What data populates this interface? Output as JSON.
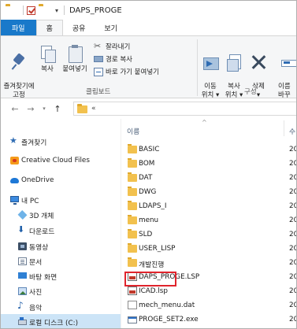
{
  "window": {
    "title": "DAPS_PROGE"
  },
  "tabs": {
    "file": "파일",
    "home": "홈",
    "share": "공유",
    "view": "보기"
  },
  "ribbon": {
    "pin": "즐겨찾기에\n고정",
    "copy": "복사",
    "paste": "붙여넣기",
    "cut": "잘라내기",
    "copy_path": "경로 복사",
    "paste_shortcut": "바로 가기 붙여넣기",
    "clipboard_group": "클립보드",
    "move_to": "이동\n위치 ▾",
    "copy_to": "복사\n위치 ▾",
    "delete": "삭제\n▾",
    "rename": "이름\n바꾸",
    "organize_group": "구성"
  },
  "address": {
    "path": "«"
  },
  "nav_pane": {
    "items": [
      {
        "label": "즐겨찾기",
        "icon": "star-icon"
      },
      {
        "label": "Creative Cloud Files",
        "icon": "creative-cloud-icon"
      },
      {
        "label": "OneDrive",
        "icon": "cloud-icon"
      },
      {
        "label": "내 PC",
        "icon": "computer-icon"
      },
      {
        "label": "3D 개체",
        "icon": "3d-objects-icon"
      },
      {
        "label": "다운로드",
        "icon": "download-icon"
      },
      {
        "label": "동영상",
        "icon": "video-icon"
      },
      {
        "label": "문서",
        "icon": "document-icon"
      },
      {
        "label": "바탕 화면",
        "icon": "desktop-icon"
      },
      {
        "label": "사진",
        "icon": "picture-icon"
      },
      {
        "label": "음악",
        "icon": "music-icon"
      },
      {
        "label": "로컬 디스크 (C:)",
        "icon": "disk-icon"
      }
    ]
  },
  "file_list": {
    "headers": {
      "name": "이름",
      "date": "수"
    },
    "rows": [
      {
        "name": "BASIC",
        "type": "folder",
        "date": "20"
      },
      {
        "name": "BOM",
        "type": "folder",
        "date": "20"
      },
      {
        "name": "DAT",
        "type": "folder",
        "date": "20"
      },
      {
        "name": "DWG",
        "type": "folder",
        "date": "20"
      },
      {
        "name": "LDAPS_I",
        "type": "folder",
        "date": "20"
      },
      {
        "name": "menu",
        "type": "folder",
        "date": "20"
      },
      {
        "name": "SLD",
        "type": "folder",
        "date": "20"
      },
      {
        "name": "USER_LISP",
        "type": "folder",
        "date": "20"
      },
      {
        "name": "개발진행",
        "type": "folder",
        "date": "20"
      },
      {
        "name": "DAPS_PROGE.LSP",
        "type": "lsp",
        "date": "20"
      },
      {
        "name": "ICAD.lsp",
        "type": "lsp",
        "date": "20"
      },
      {
        "name": "mech_menu.dat",
        "type": "dat",
        "date": "20"
      },
      {
        "name": "PROGE_SET2.exe",
        "type": "exe",
        "date": "20"
      }
    ]
  },
  "highlight_color": "#e0242c"
}
